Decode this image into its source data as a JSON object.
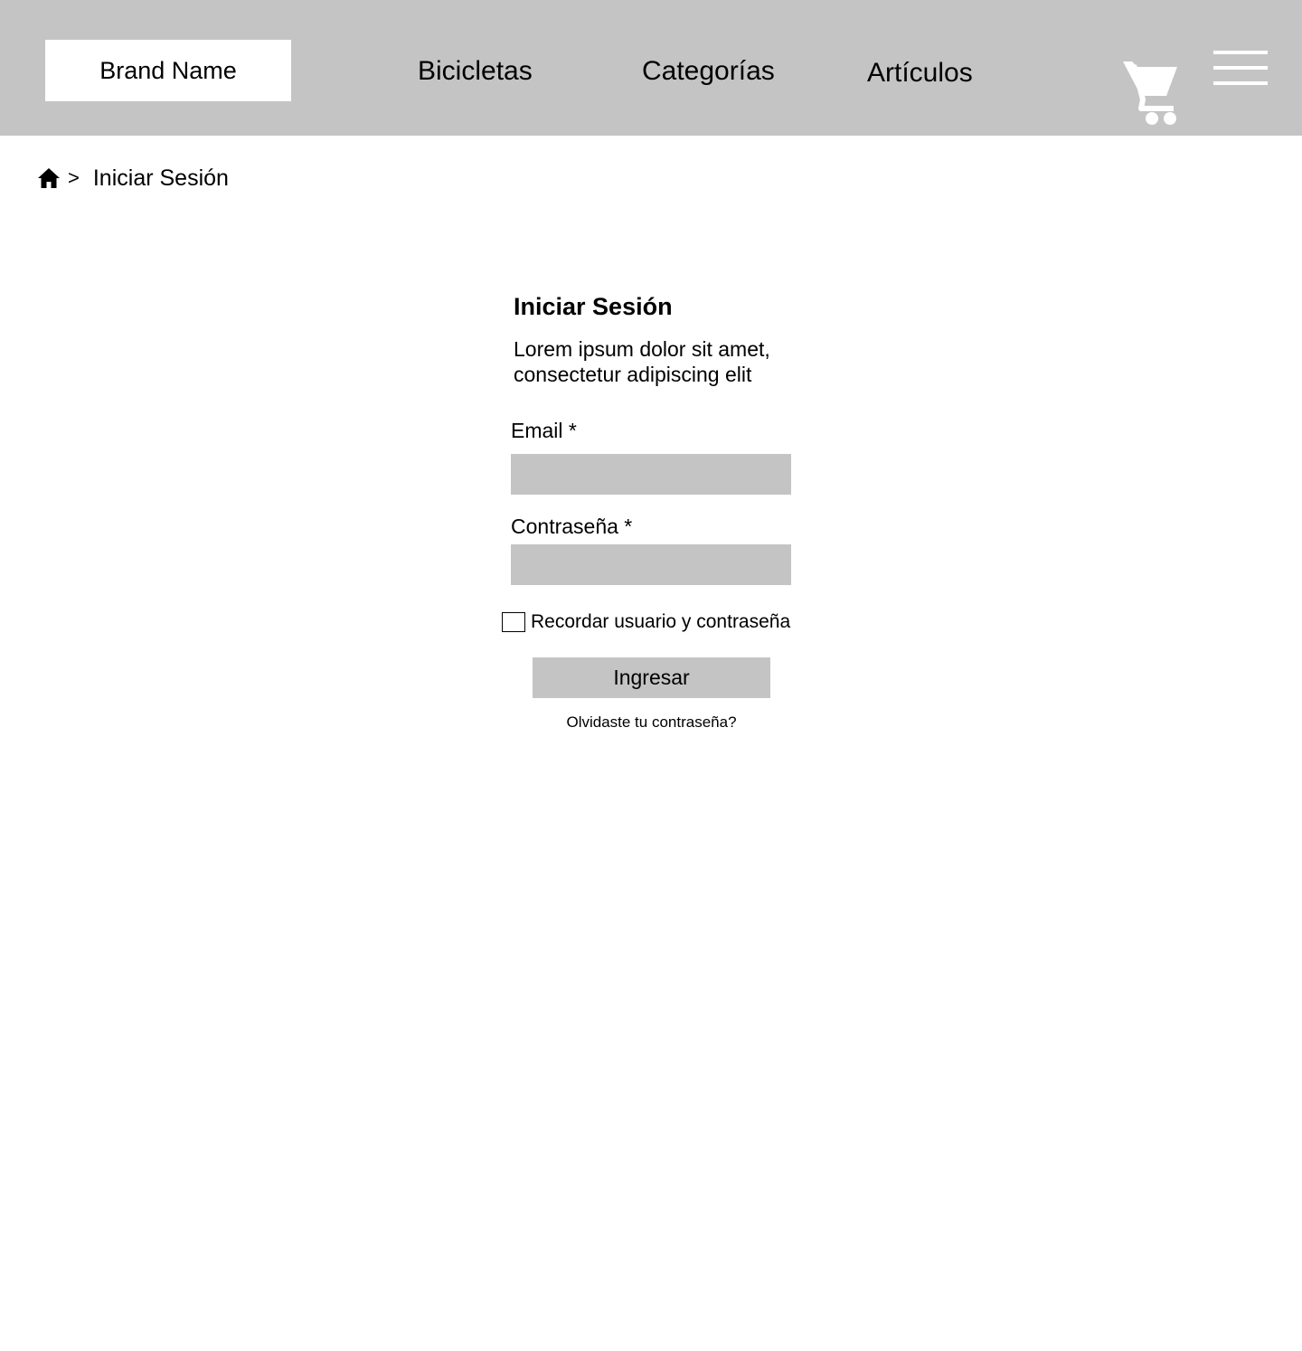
{
  "header": {
    "brand": "Brand Name",
    "nav": [
      {
        "label": "Bicicletas"
      },
      {
        "label": "Categorías"
      },
      {
        "label": "Artículos"
      }
    ],
    "cart_icon": "shopping-cart-icon",
    "menu_icon": "hamburger-menu-icon"
  },
  "breadcrumb": {
    "home_icon": "home-icon",
    "separator": ">",
    "current": "Iniciar Sesión"
  },
  "login_form": {
    "title": "Iniciar Sesión",
    "description": "Lorem ipsum dolor sit amet, consectetur adipiscing elit",
    "email_label": "Email *",
    "email_value": "",
    "password_label": "Contraseña *",
    "password_value": "",
    "remember_label": "Recordar usuario y contraseña",
    "remember_checked": false,
    "submit_label": "Ingresar",
    "forgot_label": "Olvidaste tu contraseña?"
  },
  "colors": {
    "header_bg": "#c4c4c4",
    "input_bg": "#c4c4c4",
    "button_bg": "#c4c4c4",
    "icon_light": "#ffffff"
  }
}
